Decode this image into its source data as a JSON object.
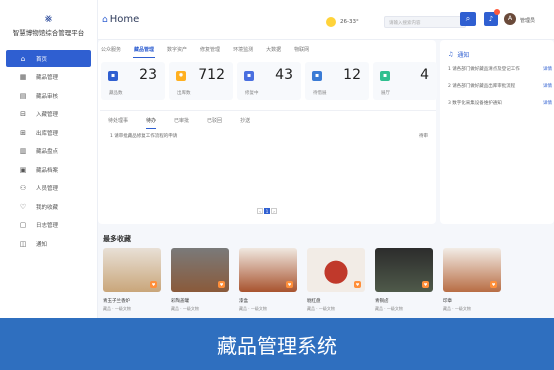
{
  "sidebar": {
    "logo_text": "智慧博物馆综合管理平台",
    "items": [
      {
        "label": "首页",
        "icon": "home-icon",
        "active": true
      },
      {
        "label": "藏品管理",
        "icon": "collection-icon",
        "active": false
      },
      {
        "label": "藏品审核",
        "icon": "review-icon",
        "active": false
      },
      {
        "label": "入藏管理",
        "icon": "store-icon",
        "active": false
      },
      {
        "label": "出库管理",
        "icon": "export-icon",
        "active": false
      },
      {
        "label": "藏品盘点",
        "icon": "inventory-icon",
        "active": false
      },
      {
        "label": "藏品档案",
        "icon": "archive-icon",
        "active": false
      },
      {
        "label": "人员管理",
        "icon": "user-icon",
        "active": false
      },
      {
        "label": "我的收藏",
        "icon": "heart-icon",
        "active": false
      },
      {
        "label": "日志管理",
        "icon": "log-icon",
        "active": false
      },
      {
        "label": "通知",
        "icon": "bell-icon",
        "active": false
      }
    ]
  },
  "header": {
    "title": "Home",
    "weather": "26-33°",
    "search_placeholder": "请输入搜索内容",
    "user_name": "管理员"
  },
  "main": {
    "top_tabs": [
      "公众服务",
      "藏品管理",
      "数字资产",
      "修复管理",
      "环境监测",
      "大数据",
      "物联网"
    ],
    "active_top_tab": 1,
    "stats": [
      {
        "value": "23",
        "label": "藏品数",
        "color": "#2f5fd1",
        "icon": "box-icon"
      },
      {
        "value": "712",
        "label": "出库数",
        "color": "#ffb020",
        "icon": "sun-icon"
      },
      {
        "value": "43",
        "label": "修复中",
        "color": "#4a6fe0",
        "icon": "tool-icon"
      },
      {
        "value": "12",
        "label": "待借展",
        "color": "#3a7bd5",
        "icon": "case-icon"
      },
      {
        "value": "4",
        "label": "展厅",
        "color": "#2fbf8f",
        "icon": "hall-icon"
      }
    ],
    "inner_tabs": [
      "待处理事",
      "待办",
      "已审批",
      "已驳回",
      "抄送"
    ],
    "active_inner_tab": 1,
    "list_item_text": "1  请审批藏品修复工作流程的申请",
    "list_item_meta": "待审",
    "pager": [
      "1"
    ]
  },
  "notice": {
    "title": "通知",
    "items": [
      {
        "text": "1 请各部门做好藏品清点及登记工作",
        "more": "详情"
      },
      {
        "text": "2 请各部门做好藏品出库审批流程",
        "more": "详情"
      },
      {
        "text": "3 数字化采集设备维护通知",
        "more": "详情"
      }
    ]
  },
  "favorites": {
    "title": "最多收藏",
    "items": [
      {
        "name": "青玉子兰香炉",
        "sub": "藏品 · 一级文物",
        "color": "#c9a67a"
      },
      {
        "name": "彩陶盖罐",
        "sub": "藏品 · 一级文物",
        "color": "#8a5a3a"
      },
      {
        "name": "漆盒",
        "sub": "藏品 · 一级文物",
        "color": "#a8532f"
      },
      {
        "name": "剔红盘",
        "sub": "藏品 · 一级文物",
        "color": "#c0392b"
      },
      {
        "name": "青铜卣",
        "sub": "藏品 · 一级文物",
        "color": "#4f5a4a"
      },
      {
        "name": "印章",
        "sub": "藏品 · 一级文物",
        "color": "#b86d44"
      }
    ]
  },
  "banner": {
    "text": "藏品管理系统"
  }
}
